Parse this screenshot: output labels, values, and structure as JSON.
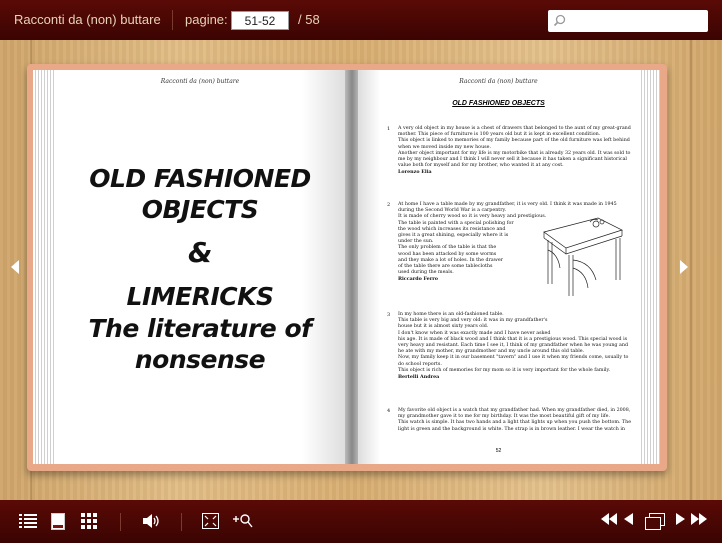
{
  "header": {
    "title": "Racconti da (non) buttare",
    "pages_label": "pagine:",
    "page_value": "51-52",
    "total": "/ 58",
    "search_placeholder": ""
  },
  "left_page": {
    "running_head": "Racconti da (non) buttare",
    "title_line1": "OLD FASHIONED",
    "title_line2": "OBJECTS",
    "ampersand": "&",
    "title_line3": "LIMERICKS",
    "title_line4": "The literature of",
    "title_line5": "nonsense"
  },
  "right_page": {
    "running_head": "Racconti da (non) buttare",
    "heading": "OLD FASHIONED OBJECTS",
    "page_number": "52",
    "entries": [
      {
        "num": "1",
        "lines": [
          "A very old object in my house is a chest of drawers that belonged to the aunt of my great-grand",
          "mother. This piece of furniture is 100 years old but it is kept in excellent condition.",
          "This object is linked to memories of my family because part of the old furniture was left behind",
          "when we moved inside my new house.",
          "Another object important for my life is my motorbike that is already 32 years old. It was sold to",
          "me by my neighbour and I think I will never sell it because it has taken a significant historical",
          "value both for myself and for my brother, who wanted it at any cost."
        ],
        "author": "Lorenzo Elia"
      },
      {
        "num": "2",
        "lines": [
          "At home I have a table made by my grandfather, it is very old. I think it was made in 1945",
          "during the Second World War is a carpentry.",
          "It is made of cherry wood so it is very heavy and prestigious.",
          "The table is painted with a special polishing for",
          "the wood which increases its resistance and",
          "gives it a great shining, especially where it is",
          "under the sun.",
          "The only problem of the table is that the",
          "wood has been attacked by some worms",
          "and they make a lot of holes. In the drawer",
          "of the table there are some tablecloths",
          "used during the meals."
        ],
        "author": "Riccardo Ferro"
      },
      {
        "num": "3",
        "lines": [
          "In my home there is an old-fashioned table.",
          "This table is very big and very old: it was in my grandfather's",
          "house but it is almost sixty years old.",
          "I don't know when it was exactly made and I have never asked",
          "his age. It is made of black wood and I think that it is a prestigious wood. This special wood is",
          "very heavy and resistant. Each time I see it, I think of my grandfather when he was young and",
          "he ate with my mother, my grandmother and my uncle around this old table.",
          "Now, my family keep it in our basement \"tavern\" and I use it when my friends come, usually to",
          "do school reports.",
          "This object is rich of memories for my mom so it is very important for the whole family."
        ],
        "author": "Bertelli Andrea"
      },
      {
        "num": "4",
        "lines": [
          "My favorite old object is a watch that my grandfather had. When my grandfather died, in 2008,",
          "my grandmother gave it to me for my birthday. It was the most beautiful gift of my life.",
          "This watch is simple. It has two hands and a light that lights up when you push the bottom. The",
          "light is green and the background is white. The strap is in brown leather. I wear the watch in"
        ],
        "author": ""
      }
    ]
  },
  "colors": {
    "bar": "#4a0704",
    "wood": "#d9b27a",
    "cover": "#e9a887"
  },
  "icons": [
    "search-icon",
    "nav-left-icon",
    "nav-right-icon",
    "list-icon",
    "single-page-icon",
    "thumbnails-icon",
    "volume-icon",
    "fullscreen-icon",
    "zoom-in-icon",
    "first-page-icon",
    "prev-page-icon",
    "two-page-icon",
    "next-page-icon",
    "last-page-icon"
  ]
}
